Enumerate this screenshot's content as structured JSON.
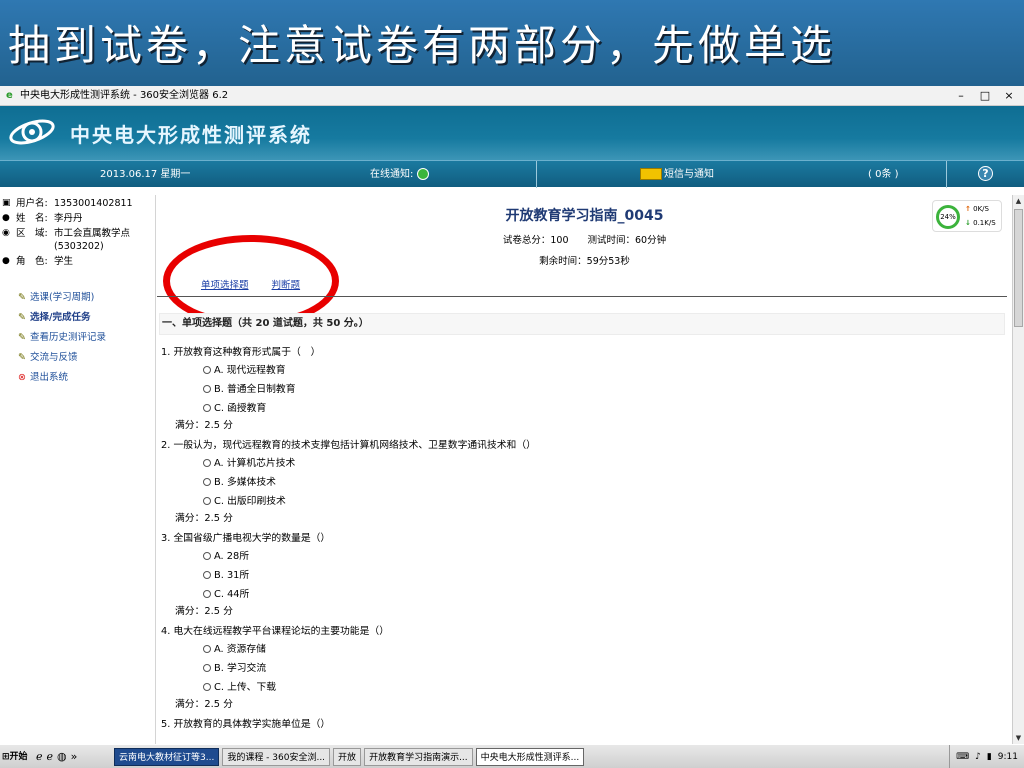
{
  "slide": {
    "banner_text": "抽到试卷，注意试卷有两部分，先做单选"
  },
  "window": {
    "title": "中央电大形成性测评系统 - 360安全浏览器 6.2",
    "buttons": [
      "–",
      "□",
      "×"
    ]
  },
  "header": {
    "system_name": "中央电大形成性测评系统"
  },
  "navbar": {
    "date": "2013.06.17 星期一",
    "online_notice": "在线通知:",
    "messages": "短信与通知",
    "count": "( 0条 )",
    "help": "?"
  },
  "user": {
    "username_label": "用户名:",
    "username": "1353001402811",
    "name_label": "姓　名:",
    "name": "李丹丹",
    "area_label": "区　域:",
    "area": "市工会直属教学点(5303202)",
    "role_label": "角　色:",
    "role": "学生"
  },
  "menu": [
    {
      "label": "选课(学习周期)"
    },
    {
      "label": "选择/完成任务"
    },
    {
      "label": "查看历史测评记录"
    },
    {
      "label": "交流与反馈"
    },
    {
      "label": "退出系统"
    }
  ],
  "exam": {
    "title": "开放教育学习指南_0045",
    "info": "试卷总分：100　　测试时间：60分钟",
    "remaining": "剩余时间：59分53秒",
    "tabs": [
      "单项选择题",
      "判断题"
    ],
    "section": "一、单项选择题（共 20 道试题，共 50 分。）"
  },
  "questions": [
    {
      "text": "1. 开放教育这种教育形式属于（　）",
      "options": [
        "A. 现代远程教育",
        "B. 普通全日制教育",
        "C. 函授教育"
      ],
      "score": "满分：2.5 分"
    },
    {
      "text": "2. 一般认为，现代远程教育的技术支撑包括计算机网络技术、卫星数字通讯技术和（）",
      "options": [
        "A. 计算机芯片技术",
        "B. 多媒体技术",
        "C. 出版印刷技术"
      ],
      "score": "满分：2.5 分"
    },
    {
      "text": "3. 全国省级广播电视大学的数量是（）",
      "options": [
        "A. 28所",
        "B. 31所",
        "C. 44所"
      ],
      "score": "满分：2.5 分"
    },
    {
      "text": "4. 电大在线远程教学平台课程论坛的主要功能是（）",
      "options": [
        "A. 资源存储",
        "B. 学习交流",
        "C. 上传、下载"
      ],
      "score": "满分：2.5 分"
    },
    {
      "text": "5. 开放教育的具体教学实施单位是（）",
      "options": [],
      "score": ""
    }
  ],
  "speed_widget": {
    "percent": "24%",
    "up": "0K/S",
    "down": "0.1K/S"
  },
  "taskbar": {
    "start": "开始",
    "tasks": [
      "云南电大教材征订等3...",
      "我的课程 - 360安全浏...",
      "开放",
      "开放教育学习指南演示...",
      "中央电大形成性测评系..."
    ],
    "time": "9:11"
  }
}
